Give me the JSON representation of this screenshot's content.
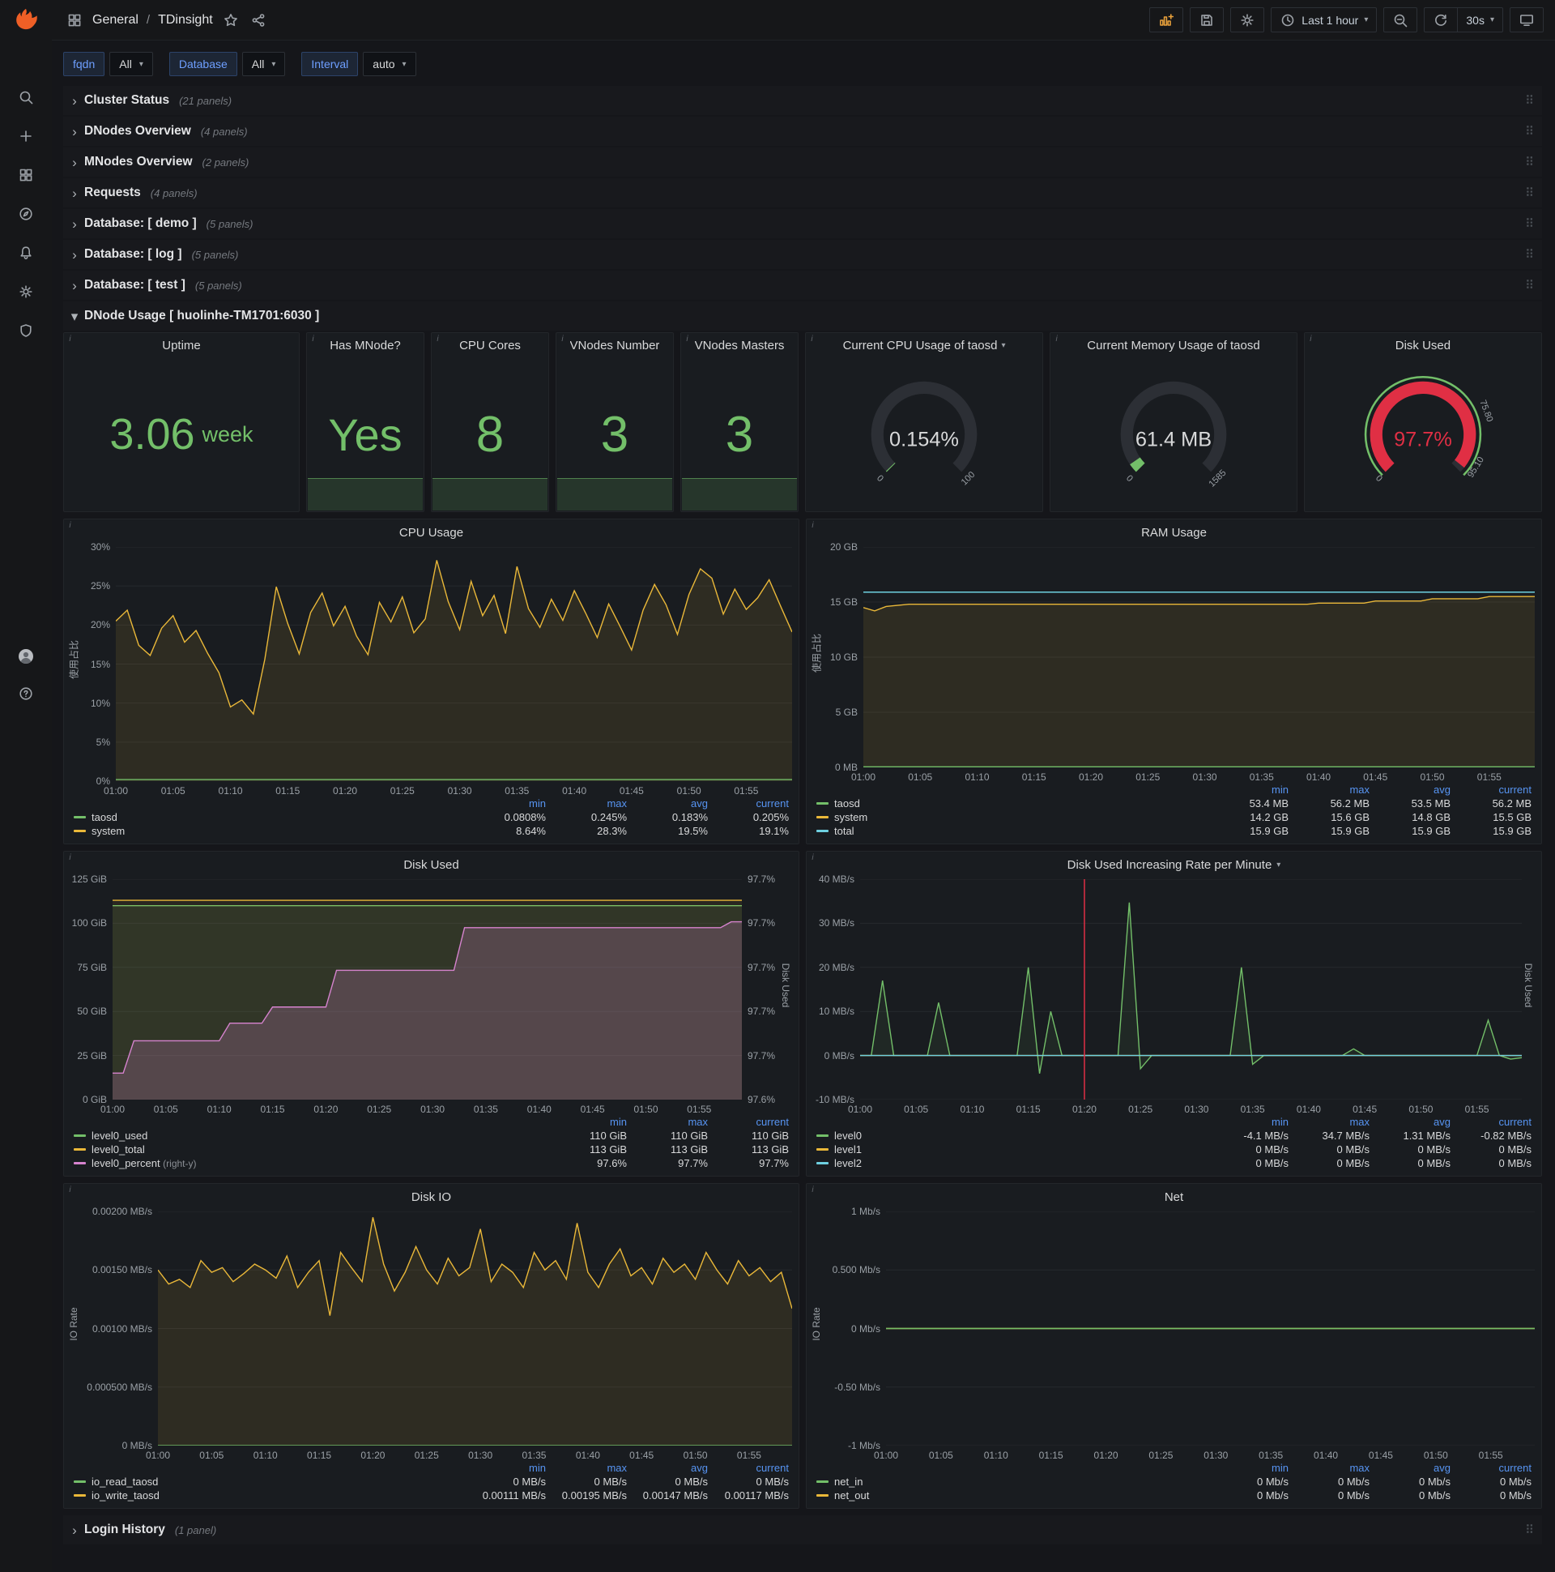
{
  "topbar": {
    "breadcrumb": {
      "folder": "General",
      "separator": "/",
      "dashboard": "TDinsight"
    },
    "right_buttons": [
      {
        "icon": "panel-add",
        "name": "add-panel-button",
        "accent": true
      },
      {
        "icon": "save",
        "name": "save-dashboard-button"
      },
      {
        "icon": "settings",
        "name": "dashboard-settings-button"
      },
      {
        "icon": "clock",
        "label": "Last 1 hour",
        "caret": true,
        "name": "time-range-picker"
      },
      {
        "icon": "zoom-out",
        "name": "zoom-out-button"
      },
      {
        "icon": "refresh",
        "name": "refresh-button",
        "join": "right"
      },
      {
        "label": "30s",
        "caret": true,
        "name": "refresh-interval-dropdown",
        "join": "left"
      },
      {
        "icon": "tv",
        "name": "cycle-view-button"
      }
    ]
  },
  "sidebar": {
    "top": [
      "search",
      "plus",
      "dashboards",
      "explore",
      "alerting",
      "settings",
      "shield"
    ],
    "bottom": [
      "avatar",
      "help"
    ]
  },
  "variables": [
    {
      "name": "fqdn",
      "label": "fqdn",
      "value": "All"
    },
    {
      "name": "database",
      "label": "Database",
      "value": "All"
    },
    {
      "name": "interval",
      "label": "Interval",
      "value": "auto"
    }
  ],
  "collapsed_rows": [
    {
      "title": "Cluster Status",
      "count": "21 panels"
    },
    {
      "title": "DNodes Overview",
      "count": "4 panels"
    },
    {
      "title": "MNodes Overview",
      "count": "2 panels"
    },
    {
      "title": "Requests",
      "count": "4 panels"
    },
    {
      "title": "Database: [ demo ]",
      "count": "5 panels"
    },
    {
      "title": "Database: [ log ]",
      "count": "5 panels"
    },
    {
      "title": "Database: [ test ]",
      "count": "5 panels"
    }
  ],
  "dnode_row": {
    "title": "DNode Usage [ huolinhe-TM1701:6030 ]"
  },
  "bottom_rows": [
    {
      "title": "Login History",
      "count": "1 panel"
    }
  ],
  "stat_panels": [
    {
      "type": "stat",
      "slug": "uptime",
      "title": "Uptime",
      "value": "3.06",
      "suffix": "week",
      "size": 54
    },
    {
      "type": "stat",
      "slug": "has-mnode",
      "title": "Has MNode?",
      "value": "Yes",
      "size": 56,
      "sparkline": true
    },
    {
      "type": "stat",
      "slug": "cpu-cores",
      "title": "CPU Cores",
      "value": "8",
      "size": 62,
      "sparkline": true
    },
    {
      "type": "stat",
      "slug": "vnodes-number",
      "title": "VNodes Number",
      "value": "3",
      "size": 62,
      "sparkline": true
    },
    {
      "type": "stat",
      "slug": "vnodes-masters",
      "title": "VNodes Masters",
      "value": "3",
      "size": 62,
      "sparkline": true
    },
    {
      "type": "gauge",
      "slug": "current-cpu-usage",
      "title": "Current CPU Usage of taosd",
      "caret": true,
      "value": "0.154%",
      "frac": 0.0035,
      "color": "#73bf69",
      "value_color": "#d8d9da",
      "scale": [
        {
          "t": "0",
          "f": 0
        },
        {
          "t": "100",
          "f": 1
        }
      ]
    },
    {
      "type": "gauge",
      "slug": "current-memory-usage",
      "title": "Current Memory Usage of taosd",
      "value": "61.4 MB",
      "frac": 0.039,
      "color": "#73bf69",
      "value_color": "#d8d9da",
      "scale": [
        {
          "t": "0",
          "f": 0
        },
        {
          "t": "1585",
          "f": 1
        }
      ]
    },
    {
      "type": "gauge",
      "slug": "disk-used-gauge",
      "title": "Disk Used",
      "value": "97.7%",
      "frac": 0.977,
      "color": "#e02f44",
      "value_color": "#e02f44",
      "ring": "#73bf69",
      "scale": [
        {
          "t": "0",
          "f": 0
        },
        {
          "t": "75.80",
          "f": 0.758
        },
        {
          "t": "95.10",
          "f": 0.951
        }
      ]
    }
  ],
  "x_ticks": [
    "01:00",
    "01:05",
    "01:10",
    "01:15",
    "01:20",
    "01:25",
    "01:30",
    "01:35",
    "01:40",
    "01:45",
    "01:50",
    "01:55"
  ],
  "charts": {
    "cpu": {
      "type": "line",
      "title": "CPU Usage",
      "y_label": "使用占比",
      "y_width": 44,
      "points": 60,
      "y_ticks": [
        "30%",
        "25%",
        "20%",
        "15%",
        "10%",
        "5%",
        "0%"
      ],
      "y_min": 0,
      "y_max": 30,
      "series": [
        {
          "name": "system",
          "color": "#eab839",
          "fill": "rgba(234,184,57,0.10)",
          "data": [
            20.5,
            21.9,
            17.4,
            16.1,
            19.6,
            21.2,
            17.8,
            19.3,
            16.4,
            13.9,
            9.5,
            10.4,
            8.6,
            15.6,
            24.9,
            20.2,
            16.3,
            21.6,
            24.1,
            19.9,
            22.4,
            18.6,
            16.2,
            22.9,
            20.4,
            23.6,
            19.0,
            20.8,
            28.3,
            23.0,
            19.4,
            25.6,
            21.2,
            23.8,
            18.9,
            27.5,
            22.1,
            19.7,
            23.3,
            20.6,
            24.4,
            21.5,
            18.4,
            22.7,
            19.8,
            16.8,
            21.9,
            25.2,
            22.6,
            18.8,
            23.9,
            27.2,
            26.0,
            21.4,
            24.6,
            22.0,
            23.5,
            25.8,
            22.4,
            19.1
          ]
        },
        {
          "name": "taosd",
          "color": "#73bf69",
          "data": 0.2
        }
      ],
      "legend": {
        "headers": [
          "min",
          "max",
          "avg",
          "current"
        ],
        "rows": [
          {
            "name": "taosd",
            "color": "#73bf69",
            "values": [
              "0.0808%",
              "0.245%",
              "0.183%",
              "0.205%"
            ]
          },
          {
            "name": "system",
            "color": "#eab839",
            "values": [
              "8.64%",
              "28.3%",
              "19.5%",
              "19.1%"
            ]
          }
        ]
      }
    },
    "ram": {
      "type": "line",
      "title": "RAM Usage",
      "y_label": "使用占比",
      "y_width": 50,
      "points": 60,
      "y_ticks": [
        "20 GB",
        "15 GB",
        "10 GB",
        "5 GB",
        "0 MB"
      ],
      "y_min": 0,
      "y_max": 20,
      "series": [
        {
          "name": "system",
          "color": "#eab839",
          "fill": "rgba(234,184,57,0.10)",
          "data": [
            14.5,
            14.2,
            14.6,
            14.7,
            14.8,
            14.8,
            14.8,
            14.8,
            14.8,
            14.8,
            14.8,
            14.8,
            14.8,
            14.8,
            14.8,
            14.8,
            14.8,
            14.8,
            14.8,
            14.8,
            14.8,
            14.8,
            14.8,
            14.8,
            14.8,
            14.8,
            14.8,
            14.8,
            14.8,
            14.8,
            14.8,
            14.8,
            14.8,
            14.8,
            14.8,
            14.8,
            14.8,
            14.8,
            14.8,
            14.8,
            14.9,
            14.9,
            14.9,
            14.9,
            14.9,
            15.1,
            15.1,
            15.1,
            15.1,
            15.1,
            15.3,
            15.3,
            15.3,
            15.3,
            15.3,
            15.5,
            15.5,
            15.5,
            15.5,
            15.5
          ]
        },
        {
          "name": "total",
          "color": "#6ed0e0",
          "data": 15.9
        },
        {
          "name": "taosd",
          "color": "#73bf69",
          "data": 0.055
        }
      ],
      "legend": {
        "headers": [
          "min",
          "max",
          "avg",
          "current"
        ],
        "rows": [
          {
            "name": "taosd",
            "color": "#73bf69",
            "values": [
              "53.4 MB",
              "56.2 MB",
              "53.5 MB",
              "56.2 MB"
            ]
          },
          {
            "name": "system",
            "color": "#eab839",
            "values": [
              "14.2 GB",
              "15.6 GB",
              "14.8 GB",
              "15.5 GB"
            ]
          },
          {
            "name": "total",
            "color": "#6ed0e0",
            "values": [
              "15.9 GB",
              "15.9 GB",
              "15.9 GB",
              "15.9 GB"
            ]
          }
        ]
      }
    },
    "disk_used": {
      "type": "area",
      "title": "Disk Used",
      "y_width": 56,
      "points": 60,
      "y_ticks": [
        "125 GiB",
        "100 GiB",
        "75 GiB",
        "50 GiB",
        "25 GiB",
        "0 GiB"
      ],
      "y_min": 0,
      "y_max": 125,
      "right_ticks": [
        "97.7%",
        "97.7%",
        "97.7%",
        "97.7%",
        "97.7%",
        "97.6%"
      ],
      "right_min": 97.56,
      "right_max": 97.71,
      "right_width": 46,
      "right_label": "Disk Used",
      "series": [
        {
          "name": "level0_used",
          "color": "#73bf69",
          "fill": "rgba(115,191,105,0.10)",
          "data": 110
        },
        {
          "name": "level0_total",
          "color": "#eab839",
          "fill": "rgba(234,184,57,0.08)",
          "data": 113
        },
        {
          "name": "level0_percent",
          "color": "#d683ce",
          "fill": "rgba(214,131,206,0.22)",
          "axis": "right",
          "data": [
            97.578,
            97.578,
            97.6,
            97.6,
            97.6,
            97.6,
            97.6,
            97.6,
            97.6,
            97.6,
            97.6,
            97.612,
            97.612,
            97.612,
            97.612,
            97.623,
            97.623,
            97.623,
            97.623,
            97.623,
            97.623,
            97.648,
            97.648,
            97.648,
            97.648,
            97.648,
            97.648,
            97.648,
            97.648,
            97.648,
            97.648,
            97.648,
            97.648,
            97.677,
            97.677,
            97.677,
            97.677,
            97.677,
            97.677,
            97.677,
            97.677,
            97.677,
            97.677,
            97.677,
            97.677,
            97.677,
            97.677,
            97.677,
            97.677,
            97.677,
            97.677,
            97.677,
            97.677,
            97.677,
            97.677,
            97.677,
            97.677,
            97.677,
            97.681,
            97.681
          ]
        }
      ],
      "legend": {
        "headers": [
          "min",
          "max",
          "current"
        ],
        "rows": [
          {
            "name": "level0_used",
            "color": "#73bf69",
            "values": [
              "110 GiB",
              "110 GiB",
              "110 GiB"
            ]
          },
          {
            "name": "level0_total",
            "color": "#eab839",
            "values": [
              "113 GiB",
              "113 GiB",
              "113 GiB"
            ]
          },
          {
            "name": "level0_percent",
            "color": "#d683ce",
            "note": "(right-y)",
            "values": [
              "97.6%",
              "97.7%",
              "97.7%"
            ]
          }
        ]
      }
    },
    "disk_rate": {
      "type": "line",
      "title": "Disk Used Increasing Rate per Minute",
      "caret": true,
      "y_width": 62,
      "points": 60,
      "y_ticks": [
        "40 MB/s",
        "30 MB/s",
        "20 MB/s",
        "10 MB/s",
        "0 MB/s",
        "-10 MB/s"
      ],
      "y_min": -10,
      "y_max": 40,
      "right_label": "Disk Used",
      "annotation": 0.339,
      "series": [
        {
          "name": "level0",
          "color": "#73bf69",
          "fill": "rgba(115,191,105,0.08)",
          "data": [
            0,
            0,
            17,
            0,
            0,
            0,
            0,
            12,
            0,
            0,
            0,
            0,
            0,
            0,
            0,
            20,
            -4.1,
            10,
            0,
            0,
            0,
            0,
            0,
            0,
            34.7,
            -3,
            0,
            0,
            0,
            0,
            0,
            0,
            0,
            0,
            20,
            -2,
            0,
            0,
            0,
            0,
            0,
            0,
            0,
            0,
            1.5,
            0,
            0,
            0,
            0,
            0,
            0,
            0,
            0,
            0,
            0,
            0,
            8,
            0,
            -0.82,
            -0.5
          ]
        },
        {
          "name": "level1",
          "color": "#eab839",
          "data": 0
        },
        {
          "name": "level2",
          "color": "#6ed0e0",
          "data": 0
        }
      ],
      "legend": {
        "headers": [
          "min",
          "max",
          "avg",
          "current"
        ],
        "rows": [
          {
            "name": "level0",
            "color": "#73bf69",
            "values": [
              "-4.1 MB/s",
              "34.7 MB/s",
              "1.31 MB/s",
              "-0.82 MB/s"
            ]
          },
          {
            "name": "level1",
            "color": "#eab839",
            "values": [
              "0 MB/s",
              "0 MB/s",
              "0 MB/s",
              "0 MB/s"
            ]
          },
          {
            "name": "level2",
            "color": "#6ed0e0",
            "values": [
              "0 MB/s",
              "0 MB/s",
              "0 MB/s",
              "0 MB/s"
            ]
          }
        ]
      }
    },
    "disk_io": {
      "type": "line",
      "title": "Disk IO",
      "y_label": "IO Rate",
      "y_width": 96,
      "points": 60,
      "y_ticks": [
        "0.00200 MB/s",
        "0.00150 MB/s",
        "0.00100 MB/s",
        "0.000500 MB/s",
        "0 MB/s"
      ],
      "y_min": 0,
      "y_max": 0.002,
      "series": [
        {
          "name": "io_write_taosd",
          "color": "#eab839",
          "fill": "rgba(234,184,57,0.10)",
          "data": [
            0.0015,
            0.00138,
            0.00142,
            0.00135,
            0.00158,
            0.00148,
            0.00152,
            0.0014,
            0.00147,
            0.00155,
            0.0015,
            0.00143,
            0.00162,
            0.00135,
            0.00148,
            0.00158,
            0.00111,
            0.00165,
            0.00152,
            0.0014,
            0.00195,
            0.00155,
            0.00132,
            0.00148,
            0.0017,
            0.0015,
            0.00138,
            0.0016,
            0.00145,
            0.00152,
            0.00185,
            0.0014,
            0.00155,
            0.00148,
            0.00135,
            0.00165,
            0.0015,
            0.00158,
            0.00142,
            0.0019,
            0.00148,
            0.00135,
            0.00155,
            0.00168,
            0.00145,
            0.00152,
            0.00138,
            0.0016,
            0.00148,
            0.00155,
            0.00142,
            0.00165,
            0.0015,
            0.00138,
            0.00158,
            0.00145,
            0.00152,
            0.0014,
            0.00148,
            0.00117
          ]
        },
        {
          "name": "io_read_taosd",
          "color": "#73bf69",
          "data": 0
        }
      ],
      "legend": {
        "headers": [
          "min",
          "max",
          "avg",
          "current"
        ],
        "rows": [
          {
            "name": "io_read_taosd",
            "color": "#73bf69",
            "values": [
              "0 MB/s",
              "0 MB/s",
              "0 MB/s",
              "0 MB/s"
            ]
          },
          {
            "name": "io_write_taosd",
            "color": "#eab839",
            "values": [
              "0.00111 MB/s",
              "0.00195 MB/s",
              "0.00147 MB/s",
              "0.00117 MB/s"
            ]
          }
        ]
      }
    },
    "net": {
      "type": "line",
      "title": "Net",
      "y_label": "IO Rate",
      "y_width": 78,
      "points": 60,
      "y_ticks": [
        "1 Mb/s",
        "0.500 Mb/s",
        "0 Mb/s",
        "-0.50 Mb/s",
        "-1 Mb/s"
      ],
      "y_min": -1,
      "y_max": 1,
      "series": [
        {
          "name": "net_out",
          "color": "#eab839",
          "data": 0
        },
        {
          "name": "net_in",
          "color": "#73bf69",
          "data": 0
        }
      ],
      "legend": {
        "headers": [
          "min",
          "max",
          "avg",
          "current"
        ],
        "rows": [
          {
            "name": "net_in",
            "color": "#73bf69",
            "values": [
              "0 Mb/s",
              "0 Mb/s",
              "0 Mb/s",
              "0 Mb/s"
            ]
          },
          {
            "name": "net_out",
            "color": "#eab839",
            "values": [
              "0 Mb/s",
              "0 Mb/s",
              "0 Mb/s",
              "0 Mb/s"
            ]
          }
        ]
      }
    }
  }
}
